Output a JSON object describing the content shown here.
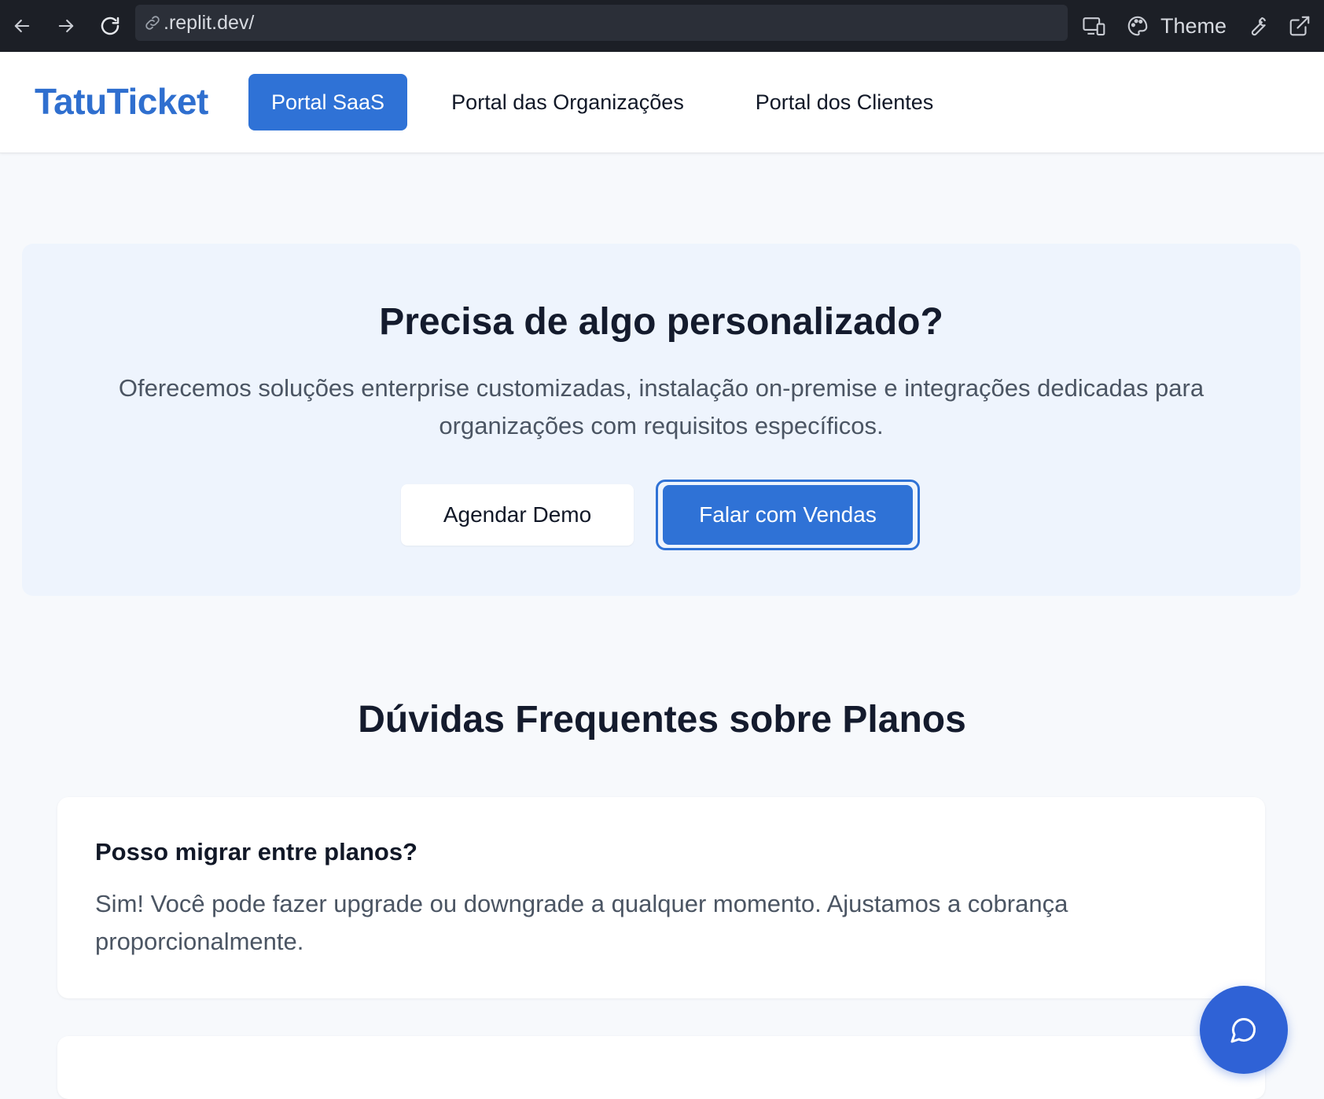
{
  "browser": {
    "url": ".replit.dev/",
    "theme_label": "Theme",
    "icons": [
      "back-arrow-icon",
      "forward-arrow-icon",
      "reload-icon",
      "link-icon",
      "devices-icon",
      "palette-icon",
      "wrench-icon",
      "external-link-icon"
    ]
  },
  "header": {
    "brand": "TatuTicket",
    "tabs": [
      {
        "label": "Portal SaaS",
        "active": true
      },
      {
        "label": "Portal das Organizações",
        "active": false
      },
      {
        "label": "Portal dos Clientes",
        "active": false
      }
    ]
  },
  "cta": {
    "title": "Precisa de algo personalizado?",
    "description": "Oferecemos soluções enterprise customizadas, instalação on-premise e integrações dedicadas para organizações com requisitos específicos.",
    "demo_button": "Agendar Demo",
    "sales_button": "Falar com Vendas"
  },
  "faq": {
    "title": "Dúvidas Frequentes sobre Planos",
    "items": [
      {
        "question": "Posso migrar entre planos?",
        "answer": "Sim! Você pode fazer upgrade ou downgrade a qualquer momento. Ajustamos a cobrança proporcionalmente."
      }
    ]
  },
  "chat": {
    "icon": "chat-bubble-icon"
  },
  "colors": {
    "brand": "#2f6fcf",
    "primary_button": "#2f72d6",
    "chrome_bg": "#1c1f26",
    "cta_bg": "#eef4fd",
    "page_bg": "#f7f9fc"
  }
}
